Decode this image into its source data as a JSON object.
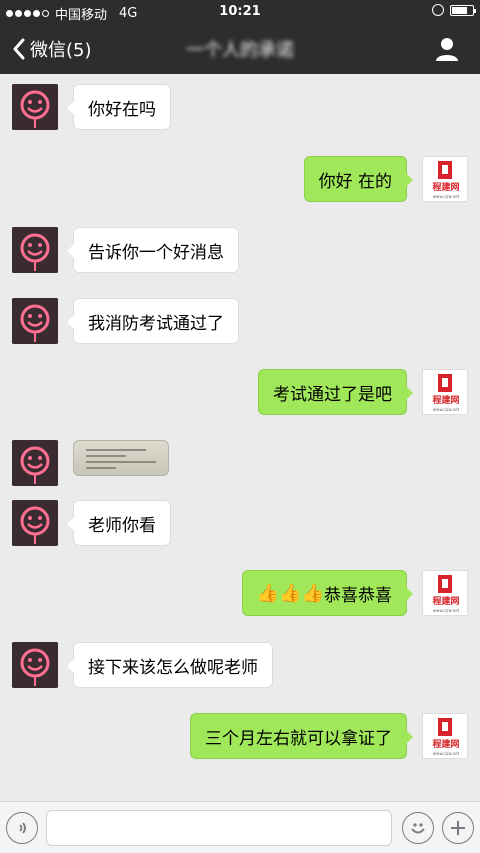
{
  "status_bar": {
    "carrier": "中国移动",
    "network": "4G",
    "time": "10:21"
  },
  "nav": {
    "back_label": "微信(5)",
    "title": "一个人的承诺"
  },
  "messages": [
    {
      "side": "in",
      "text": "你好在吗"
    },
    {
      "side": "out",
      "text": "你好 在的"
    },
    {
      "side": "in",
      "text": "告诉你一个好消息"
    },
    {
      "side": "in",
      "text": "我消防考试通过了"
    },
    {
      "side": "out",
      "text": "考试通过了是吧"
    },
    {
      "side": "in",
      "type": "image"
    },
    {
      "side": "in",
      "text": "老师你看"
    },
    {
      "side": "out",
      "emoji_prefix": "👍👍👍",
      "text": "恭喜恭喜"
    },
    {
      "side": "in",
      "text": "接下来该怎么做呢老师"
    },
    {
      "side": "out",
      "text": "三个月左右就可以拿证了"
    }
  ],
  "contact_avatar": {
    "brand_text": "程建网",
    "brand_sub": "www.cjrw.net"
  },
  "colors": {
    "topbar": "#2d2d30",
    "background": "#ebebeb",
    "out_bubble": "#a0e75a",
    "in_bubble": "#ffffff"
  },
  "icons": {
    "voice": "voice-icon",
    "emoji": "emoji-icon",
    "plus": "plus-icon",
    "profile": "profile-icon",
    "back": "chevron-left-icon"
  }
}
